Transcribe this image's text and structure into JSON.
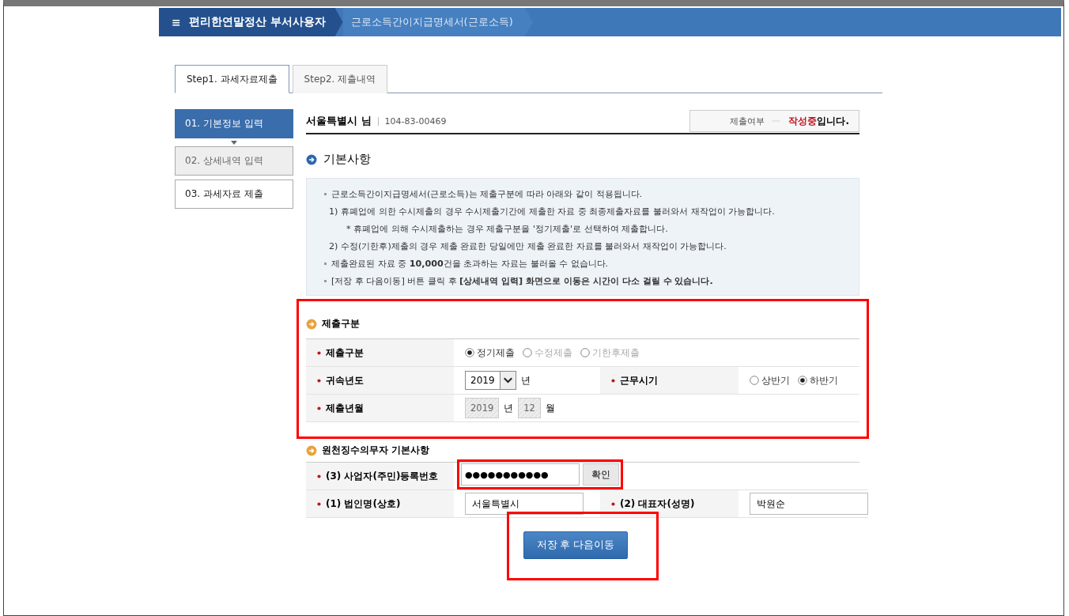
{
  "header": {
    "menu_icon": "≡",
    "title": "편리한연말정산 부서사용자",
    "breadcrumb": "근로소득간이지급명세서(근로소득)"
  },
  "tabs": [
    {
      "label": "Step1. 과세자료제출",
      "selected": true
    },
    {
      "label": "Step2. 제출내역",
      "selected": false
    }
  ],
  "steps": [
    {
      "label": "01. 기본정보 입력",
      "selected": true,
      "disabled": false
    },
    {
      "label": "02. 상세내역 입력",
      "selected": false,
      "disabled": true
    },
    {
      "label": "03. 과세자료 제출",
      "selected": false,
      "disabled": false
    }
  ],
  "user": {
    "name": "서울특별시 님",
    "id": "104-83-00469"
  },
  "status": {
    "label": "제출여부",
    "value": "작성중",
    "suffix": "입니다."
  },
  "section_title": "기본사항",
  "notes": [
    {
      "kind": "bullet",
      "text": "근로소득간이지급명세서(근로소득)는 제출구분에 따라 아래와 같이 적용됩니다."
    },
    {
      "kind": "numbered",
      "text": "1) 휴폐업에 의한 수시제출의 경우 수시제출기간에 제출한 자료 중 최종제출자료를 불러와서 재작업이 가능합니다."
    },
    {
      "kind": "sub",
      "text": "* 휴폐업에 의해 수시제출하는 경우 제출구분을 '정기제출'로 선택하여 제출합니다."
    },
    {
      "kind": "numbered",
      "text": "2) 수정(기한후)제출의 경우 제출 완료한 당일에만 제출 완료한 자료를 불러와서 재작업이 가능합니다."
    },
    {
      "kind": "bullet",
      "text": "제출완료된 자료 중 **10,000**건을 초과하는 자료는 불러올 수 없습니다."
    },
    {
      "kind": "bullet",
      "text": "[저장 후 다음이동] 버튼 클릭 후 **[상세내역 입력] 화면으로 이동은 시간이 다소 걸릴 수 있습니다.**"
    }
  ],
  "submission": {
    "highlighted": true,
    "title": "제출구분",
    "submission_type": {
      "label": "제출구분",
      "required": true,
      "options": [
        {
          "label": "정기제출",
          "selected": true,
          "disabled": false
        },
        {
          "label": "수정제출",
          "selected": false,
          "disabled": true
        },
        {
          "label": "기한후제출",
          "selected": false,
          "disabled": true
        }
      ]
    },
    "year": {
      "label": "귀속년도",
      "required": true,
      "value": "2019",
      "unit": "년"
    },
    "work_period": {
      "label": "근무시기",
      "required": true,
      "options": [
        {
          "label": "상반기",
          "selected": false,
          "disabled": false
        },
        {
          "label": "하반기",
          "selected": true,
          "disabled": false
        }
      ]
    },
    "submit_month": {
      "label": "제출년월",
      "required": true,
      "year": "2019",
      "year_unit": "년",
      "month": "12",
      "month_unit": "월"
    }
  },
  "withholder": {
    "title": "원천징수의무자 기본사항",
    "registration": {
      "label": "(3) 사업자(주민)등록번호",
      "required": true,
      "value": "●●●●●●●●●●●",
      "button": "확인",
      "highlighted": true
    },
    "corporation": {
      "label": "(1) 법인명(상호)",
      "required": true,
      "value": "서울특별시"
    },
    "representative": {
      "label": "(2) 대표자(성명)",
      "required": true,
      "value": "박원순"
    }
  },
  "save_button": {
    "label": "저장 후 다음이동",
    "highlighted": true
  }
}
